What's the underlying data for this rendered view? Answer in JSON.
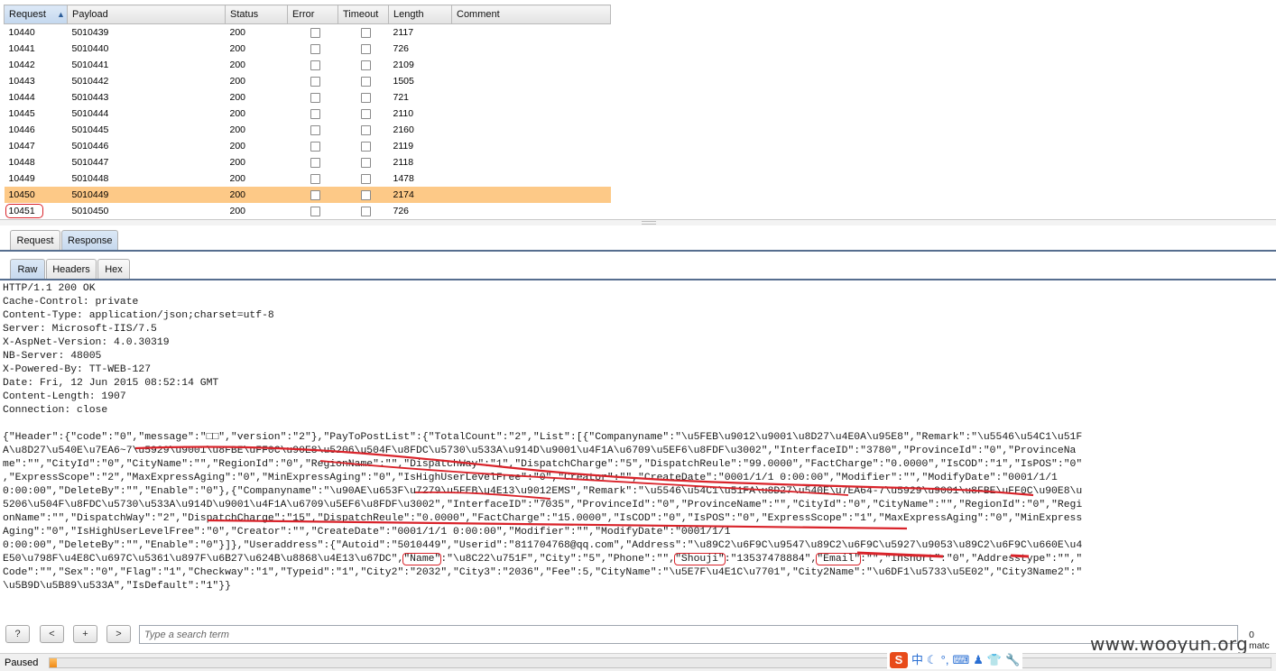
{
  "table": {
    "columns": [
      "Request",
      "Payload",
      "Status",
      "Error",
      "Timeout",
      "Length",
      "Comment"
    ],
    "rows": [
      {
        "request": "10440",
        "payload": "5010439",
        "status": "200",
        "length": "2117"
      },
      {
        "request": "10441",
        "payload": "5010440",
        "status": "200",
        "length": "726"
      },
      {
        "request": "10442",
        "payload": "5010441",
        "status": "200",
        "length": "2109"
      },
      {
        "request": "10443",
        "payload": "5010442",
        "status": "200",
        "length": "1505"
      },
      {
        "request": "10444",
        "payload": "5010443",
        "status": "200",
        "length": "721"
      },
      {
        "request": "10445",
        "payload": "5010444",
        "status": "200",
        "length": "2110"
      },
      {
        "request": "10446",
        "payload": "5010445",
        "status": "200",
        "length": "2160"
      },
      {
        "request": "10447",
        "payload": "5010446",
        "status": "200",
        "length": "2119"
      },
      {
        "request": "10448",
        "payload": "5010447",
        "status": "200",
        "length": "2118"
      },
      {
        "request": "10449",
        "payload": "5010448",
        "status": "200",
        "length": "1478"
      },
      {
        "request": "10450",
        "payload": "5010449",
        "status": "200",
        "length": "2174",
        "selected": true
      },
      {
        "request": "10451",
        "payload": "5010450",
        "status": "200",
        "length": "726",
        "circled": true
      }
    ]
  },
  "tabs_main": [
    "Request",
    "Response"
  ],
  "tabs_view": [
    "Raw",
    "Headers",
    "Hex"
  ],
  "response": {
    "headers": [
      "HTTP/1.1 200 OK",
      "Cache-Control: private",
      "Content-Type: application/json;charset=utf-8",
      "Server: Microsoft-IIS/7.5",
      "X-AspNet-Version: 4.0.30319",
      "NB-Server: 48005",
      "X-Powered-By: TT-WEB-127",
      "Date: Fri, 12 Jun 2015 08:52:14 GMT",
      "Content-Length: 1907",
      "Connection: close"
    ],
    "body": [
      "{\"Header\":{\"code\":\"0\",\"message\":\"□□\",\"version\":\"2\"},\"PayToPostList\":{\"TotalCount\":\"2\",\"List\":[{\"Companyname\":\"\\u5FEB\\u9012\\u9001\\u8D27\\u4E0A\\u95E8\",\"Remark\":\"\\u5546\\u54C1\\u51F",
      "A\\u8D27\\u540E\\u7EA6~7\\u5929\\u9001\\u8FBE\\uFF0C\\u90E8\\u5206\\u504F\\u8FDC\\u5730\\u533A\\u914D\\u9001\\u4F1A\\u6709\\u5EF6\\u8FDF\\u3002\",\"InterfaceID\":\"3780\",\"ProvinceId\":\"0\",\"ProvinceNa",
      "me\":\"\",\"CityId\":\"0\",\"CityName\":\"\",\"RegionId\":\"0\",\"RegionName\":\"\",\"DispatchWay\":\"1\",\"DispatchCharge\":\"5\",\"DispatchReule\":\"99.0000\",\"FactCharge\":\"0.0000\",\"IsCOD\":\"1\",\"IsPOS\":\"0\"",
      ",\"ExpressScope\":\"2\",\"MaxExpressAging\":\"0\",\"MinExpressAging\":\"0\",\"IsHighUserLevelFree\":\"0\",\"Creator\":\"\",\"CreateDate\":\"0001/1/1 0:00:00\",\"Modifier\":\"\",\"ModifyDate\":\"0001/1/1",
      "0:00:00\",\"DeleteBy\":\"\",\"Enable\":\"0\"},{\"Companyname\":\"\\u90AE\\u653F\\u7279\\u5FEB\\u4E13\\u9012EMS\",\"Remark\":\"\\u5546\\u54C1\\u51FA\\u8D27\\u540E\\u7EA64-7\\u5929\\u9001\\u8FBE\\uFF0C\\u90E8\\u",
      "5206\\u504F\\u8FDC\\u5730\\u533A\\u914D\\u9001\\u4F1A\\u6709\\u5EF6\\u8FDF\\u3002\",\"InterfaceID\":\"7035\",\"ProvinceId\":\"0\",\"ProvinceName\":\"\",\"CityId\":\"0\",\"CityName\":\"\",\"RegionId\":\"0\",\"Regi",
      "onName\":\"\",\"DispatchWay\":\"2\",\"DispatchCharge\":\"15\",\"DispatchReule\":\"0.0000\",\"FactCharge\":\"15.0000\",\"IsCOD\":\"0\",\"IsPOS\":\"0\",\"ExpressScope\":\"1\",\"MaxExpressAging\":\"0\",\"MinExpress",
      "Aging\":\"0\",\"IsHighUserLevelFree\":\"0\",\"Creator\":\"\",\"CreateDate\":\"0001/1/1 0:00:00\",\"Modifier\":\"\",\"ModifyDate\":\"0001/1/1",
      "0:00:00\",\"DeleteBy\":\"\",\"Enable\":\"0\"}]},\"Useraddress\":{\"Autoid\":\"5010449\",\"Userid\":\"811704768@qq.com\",\"Address\":\"\\u89C2\\u6F9C\\u9547\\u89C2\\u6F9C\\u5927\\u9053\\u89C2\\u6F9C\\u660E\\u4",
      "E50\\u798F\\u4E8C\\u697C\\u5361\\u897F\\u6B27\\u624B\\u8868\\u4E13\\u67DC\",\"Name\":\"\\u8C22\\u751F\",\"City\":\"5\",\"Phone\":\"\",\"Shouji\":\"13537478884\",\"Email\":\"\",\"Inshort\":\"0\",\"Addresstype\":\"\",\"",
      "Code\":\"\",\"Sex\":\"0\",\"Flag\":\"1\",\"Checkway\":\"1\",\"Typeid\":\"1\",\"City2\":\"2032\",\"City3\":\"2036\",\"Fee\":5,\"CityName\":\"\\u5E7F\\u4E1C\\u7701\",\"City2Name\":\"\\u6DF1\\u5733\\u5E02\",\"City3Name2\":\"",
      "\\u5B9D\\u5B89\\u533A\",\"IsDefault\":\"1\"}}"
    ]
  },
  "search": {
    "placeholder": "Type a search term",
    "match_count": "0 matc"
  },
  "buttons": {
    "help": "?",
    "prev": "<",
    "add": "+",
    "next": ">"
  },
  "status": {
    "text": "Paused",
    "progress_fraction": 0.005
  },
  "watermark": "www.wooyun.org",
  "ime": {
    "logo": "S",
    "mode": "中"
  },
  "colors": {
    "selected_row": "#fdc987",
    "annotation": "#d9232a",
    "tab_underline": "#566e8f"
  }
}
